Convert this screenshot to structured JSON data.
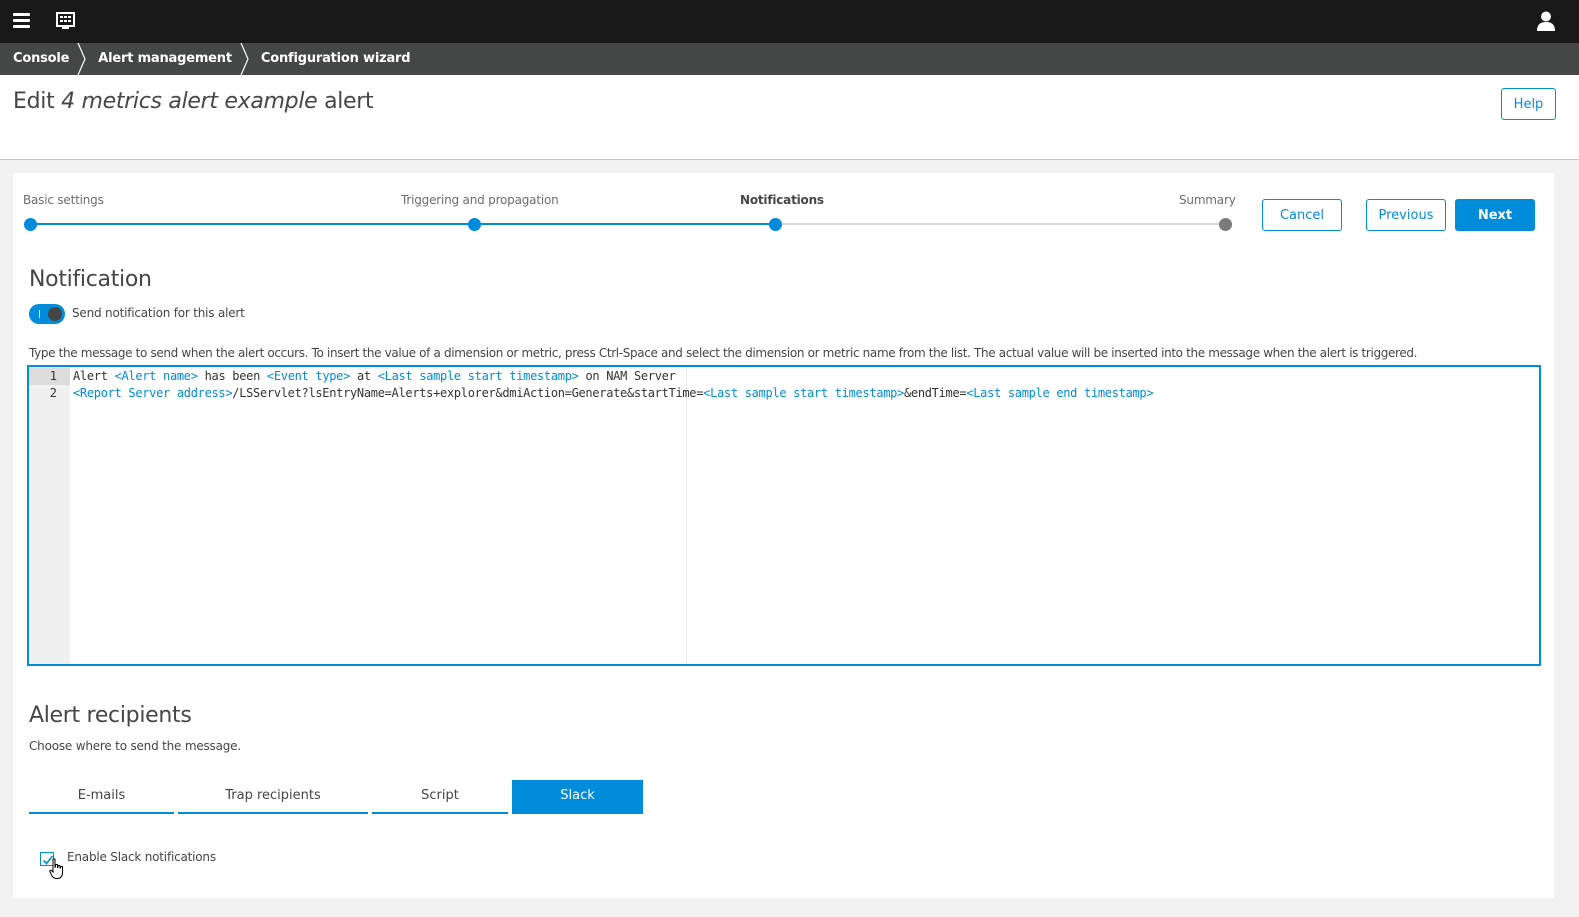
{
  "breadcrumb": [
    "Console",
    "Alert management",
    "Configuration wizard"
  ],
  "header": {
    "title_prefix": "Edit ",
    "title_name": "4 metrics alert example",
    "title_suffix": " alert",
    "help_label": "Help"
  },
  "stepper": {
    "steps": [
      {
        "label": "Basic settings",
        "state": "done"
      },
      {
        "label": "Triggering and propagation",
        "state": "done"
      },
      {
        "label": "Notifications",
        "state": "current"
      },
      {
        "label": "Summary",
        "state": "pending"
      }
    ],
    "cancel_label": "Cancel",
    "previous_label": "Previous",
    "next_label": "Next"
  },
  "notification": {
    "title": "Notification",
    "toggle_label": "Send notification for this alert",
    "toggle_on": true,
    "instructions": "Type the message to send when the alert occurs. To insert the value of a dimension or metric, press Ctrl-Space and select the dimension or metric name from the list. The actual value will be inserted into the message when the alert is triggered."
  },
  "editor": {
    "line_numbers": [
      "1",
      "2"
    ],
    "line1": {
      "t1": "Alert ",
      "v1": "<Alert name>",
      "t2": " has been ",
      "v2": "<Event type>",
      "t3": " at ",
      "v3": "<Last sample start timestamp>",
      "t4": " on NAM Server"
    },
    "line2": {
      "v1": "<Report Server address>",
      "t1": "/LSServlet?lsEntryName=Alerts+explorer&dmiAction=Generate&startTime=",
      "v2": "<Last sample start timestamp>",
      "t2": "&endTime=",
      "v3": "<Last sample end timestamp>"
    }
  },
  "recipients": {
    "title": "Alert recipients",
    "description": "Choose where to send the message.",
    "tabs": [
      {
        "label": "E-mails",
        "active": false
      },
      {
        "label": "Trap recipients",
        "active": false
      },
      {
        "label": "Script",
        "active": false
      },
      {
        "label": "Slack",
        "active": true
      }
    ],
    "slack_checkbox_label": "Enable Slack notifications",
    "slack_checked": true
  },
  "colors": {
    "accent": "#008cdb",
    "topbar": "#191919",
    "breadcrumb": "#454646",
    "pending_step": "#7b7b7b"
  },
  "icons": [
    "menu-icon",
    "dashboard-icon",
    "user-icon",
    "checkmark-icon",
    "hand-cursor-icon"
  ]
}
